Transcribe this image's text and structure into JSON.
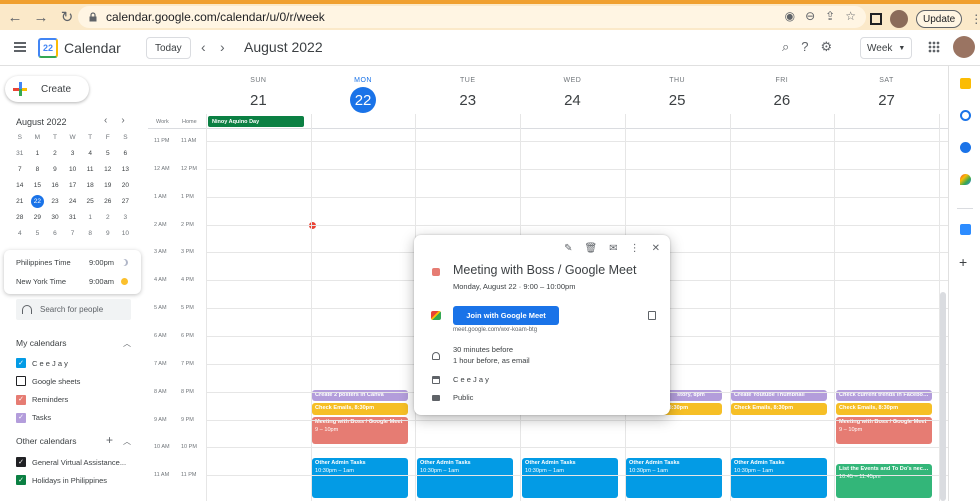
{
  "browser": {
    "url": "calendar.google.com/calendar/u/0/r/week",
    "update_label": "Update"
  },
  "header": {
    "app_title": "Calendar",
    "logo_day": "22",
    "today_label": "Today",
    "month_title": "August 2022",
    "view_label": "Week"
  },
  "sidebar": {
    "create_label": "Create",
    "mini_calendar": {
      "title": "August 2022",
      "dow": [
        "S",
        "M",
        "T",
        "W",
        "T",
        "F",
        "S"
      ],
      "weeks": [
        [
          "31",
          "1",
          "2",
          "3",
          "4",
          "5",
          "6"
        ],
        [
          "7",
          "8",
          "9",
          "10",
          "11",
          "12",
          "13"
        ],
        [
          "14",
          "15",
          "16",
          "17",
          "18",
          "19",
          "20"
        ],
        [
          "21",
          "22",
          "23",
          "24",
          "25",
          "26",
          "27"
        ],
        [
          "28",
          "29",
          "30",
          "31",
          "1",
          "2",
          "3"
        ],
        [
          "4",
          "5",
          "6",
          "7",
          "8",
          "9",
          "10"
        ]
      ],
      "selected": "22"
    },
    "timezones": [
      {
        "name": "Philippines Time",
        "time": "9:00pm"
      },
      {
        "name": "New York Time",
        "time": "9:00am"
      }
    ],
    "search_people": "Search for people",
    "my_calendars_title": "My calendars",
    "my_calendars": [
      {
        "label": "C e e J a y",
        "color": "#039be5",
        "checked": true
      },
      {
        "label": "Google sheets",
        "color": "#ffffff",
        "checked": false
      },
      {
        "label": "Reminders",
        "color": "#e67c73",
        "checked": true
      },
      {
        "label": "Tasks",
        "color": "#b39ddb",
        "checked": true
      }
    ],
    "other_calendars_title": "Other calendars",
    "other_calendars": [
      {
        "label": "General Virtual Assistance...",
        "color": "#202124",
        "checked": true
      },
      {
        "label": "Holidays in Philippines",
        "color": "#0b8043",
        "checked": true
      }
    ]
  },
  "week": {
    "days": [
      {
        "dow": "SUN",
        "num": "21"
      },
      {
        "dow": "MON",
        "num": "22",
        "current": true
      },
      {
        "dow": "TUE",
        "num": "23"
      },
      {
        "dow": "WED",
        "num": "24"
      },
      {
        "dow": "THU",
        "num": "25"
      },
      {
        "dow": "FRI",
        "num": "26"
      },
      {
        "dow": "SAT",
        "num": "27"
      }
    ],
    "tz_labels": [
      "Work",
      "Home"
    ],
    "hours_work": [
      "11 PM",
      "12 AM",
      "1 AM",
      "2 AM",
      "3 AM",
      "4 AM",
      "5 AM",
      "6 AM",
      "7 AM",
      "8 AM",
      "9 AM",
      "10 AM",
      "11 AM"
    ],
    "hours_home": [
      "11 AM",
      "12 PM",
      "1 PM",
      "2 PM",
      "3 PM",
      "4 PM",
      "5 PM",
      "6 PM",
      "7 PM",
      "8 PM",
      "9 PM",
      "10 PM",
      "11 PM"
    ],
    "holiday": "Ninoy Aquino Day",
    "events": {
      "mon_task": "Create 2 posters in Canva",
      "mon_check": "Check Emails, 8:30pm",
      "mon_meet_title": "Meeting with Boss / Google Meet",
      "mon_meet_time": "9 – 10pm",
      "mon_admin_title": "Other Admin Tasks",
      "mon_admin_time": "10:30pm – 1am",
      "tue_admin_title": "Other Admin Tasks",
      "tue_admin_time": "10:30pm – 1am",
      "wed_admin_title": "Other Admin Tasks",
      "wed_admin_time": "10:30pm – 1am",
      "thu_task": "story, 8pm",
      "thu_check": "Check Emails, 8:30pm",
      "thu_admin_title": "Other Admin Tasks",
      "thu_admin_time": "10:30pm – 1am",
      "fri_task": "Create Youtube Thumbnail",
      "fri_check": "Check Emails, 8:30pm",
      "fri_admin_title": "Other Admin Tasks",
      "fri_admin_time": "10:30pm – 1am",
      "sat_task": "Check current trends in Facebook",
      "sat_check": "Check Emails, 8:30pm",
      "sat_meet_title": "Meeting with Boss / Google Meet",
      "sat_meet_time": "9 – 10pm",
      "sat_list_title": "List the Events and To Do's necessary",
      "sat_list_time": "10:45 – 11:45pm"
    }
  },
  "popup": {
    "title": "Meeting with Boss / Google Meet",
    "subtitle": "Monday, August 22  ·  9:00 – 10:00pm",
    "join_label": "Join with Google Meet",
    "meet_url": "meet.google.com/wxr-koam-btg",
    "reminder_1": "30 minutes before",
    "reminder_2": "1 hour before, as email",
    "calendar": "C e e J a y",
    "visibility": "Public"
  },
  "colors": {
    "accent": "#1a73e8",
    "holiday": "#0b8043",
    "event_blue": "#039be5",
    "event_red": "#e67c73",
    "event_yellow": "#f6bf26",
    "event_task": "#b39ddb",
    "event_green": "#33b679",
    "now_line": "#ea4335"
  }
}
